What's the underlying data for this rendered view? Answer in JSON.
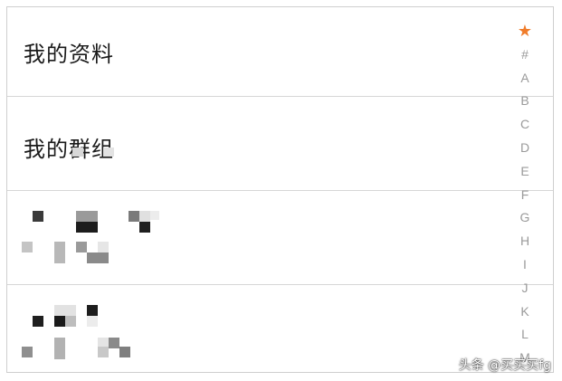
{
  "rows": {
    "profile_label": "我的资料",
    "groups_label": "我的群组"
  },
  "index_bar": {
    "star": "★",
    "letters": [
      "#",
      "A",
      "B",
      "C",
      "D",
      "E",
      "F",
      "G",
      "H",
      "I",
      "J",
      "K",
      "L",
      "M"
    ],
    "star_color": "#f07c2a"
  },
  "watermark": "头条 @买买买fg"
}
